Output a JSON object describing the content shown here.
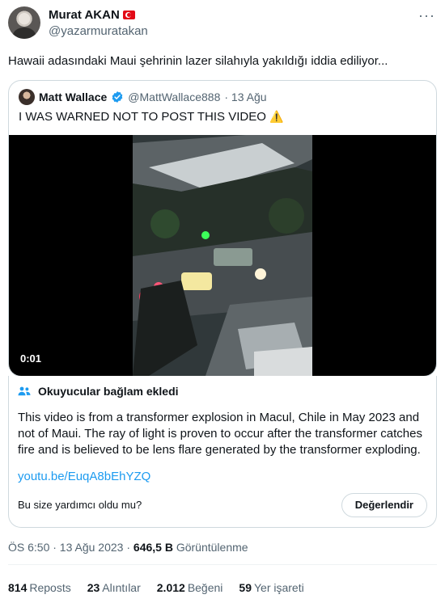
{
  "tweet": {
    "author_name": "Murat AKAN",
    "author_handle": "@yazarmuratakan",
    "text": "Hawaii adasındaki Maui şehrinin lazer silahıyla yakıldığı iddia ediliyor...",
    "timestamp": "ÖS 6:50 · 13 Ağu 2023",
    "views_count": "646,5 B",
    "views_label": "Görüntülenme"
  },
  "quoted_tweet": {
    "author_name": "Matt Wallace",
    "author_handle": "@MattWallace888",
    "date": "· 13 Ağu",
    "text": "I WAS WARNED NOT TO POST THIS VIDEO",
    "video_duration": "0:01"
  },
  "community_note": {
    "title": "Okuyucular bağlam ekledi",
    "body": "This video is from a transformer explosion in Macul, Chile in May 2023 and not of Maui. The ray of light is proven to occur after the transformer catches fire and is believed to be lens flare generated by the transformer exploding.",
    "link": "youtu.be/EuqA8bEhYZQ",
    "helpful_question": "Bu size yardımcı oldu mu?",
    "rate_button": "Değerlendir"
  },
  "stats": [
    {
      "count": "814",
      "label": "Reposts"
    },
    {
      "count": "23",
      "label": "Alıntılar"
    },
    {
      "count": "2.012",
      "label": "Beğeni"
    },
    {
      "count": "59",
      "label": "Yer işareti"
    }
  ],
  "icons": {
    "flag": "turkey-flag-icon",
    "more": "more-horizontal-icon",
    "verified": "verified-badge-icon",
    "warning": "warning-icon",
    "notes": "people-icon"
  },
  "colors": {
    "accent": "#1d9bf0",
    "text_secondary": "#536471",
    "border": "#cfd9de"
  }
}
